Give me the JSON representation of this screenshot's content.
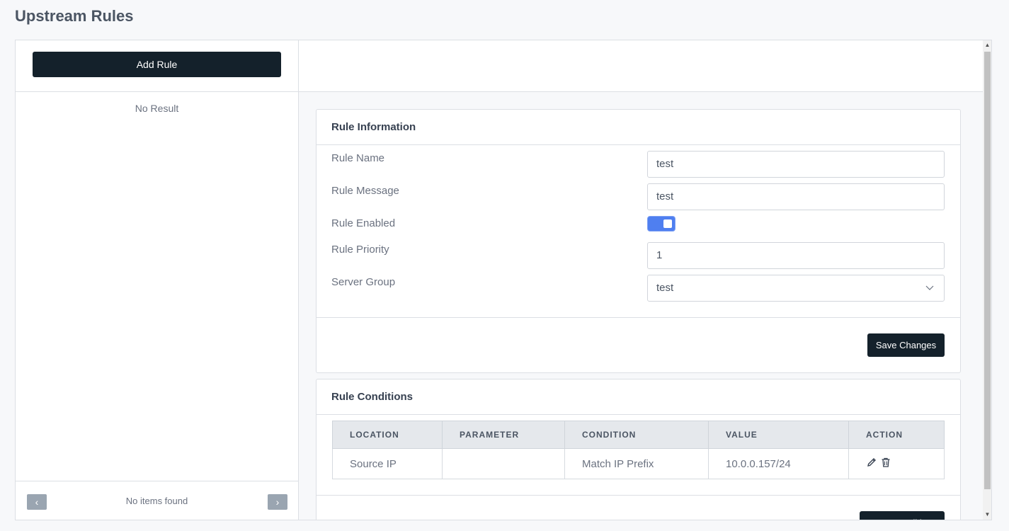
{
  "page": {
    "title": "Upstream Rules"
  },
  "sidebar": {
    "add_rule_label": "Add Rule",
    "empty_text": "No Result",
    "pager": {
      "prev_icon": "‹",
      "next_icon": "›",
      "status_text": "No items found"
    }
  },
  "rule_info": {
    "title": "Rule Information",
    "fields": {
      "name": {
        "label": "Rule Name",
        "value": "test"
      },
      "message": {
        "label": "Rule Message",
        "value": "test"
      },
      "enabled": {
        "label": "Rule Enabled",
        "value": true
      },
      "priority": {
        "label": "Rule Priority",
        "value": "1"
      },
      "server_group": {
        "label": "Server Group",
        "value": "test"
      }
    },
    "save_label": "Save Changes"
  },
  "conditions": {
    "title": "Rule Conditions",
    "columns": [
      "LOCATION",
      "PARAMETER",
      "CONDITION",
      "VALUE",
      "ACTION"
    ],
    "rows": [
      {
        "location": "Source IP",
        "parameter": "",
        "condition": "Match IP Prefix",
        "value": "10.0.0.157/24",
        "actions": [
          "edit-icon",
          "trash-icon"
        ]
      }
    ],
    "new_condition_label": "New Condition"
  },
  "colors": {
    "primary_dark": "#14212b",
    "toggle_on": "#4f7ff0"
  }
}
